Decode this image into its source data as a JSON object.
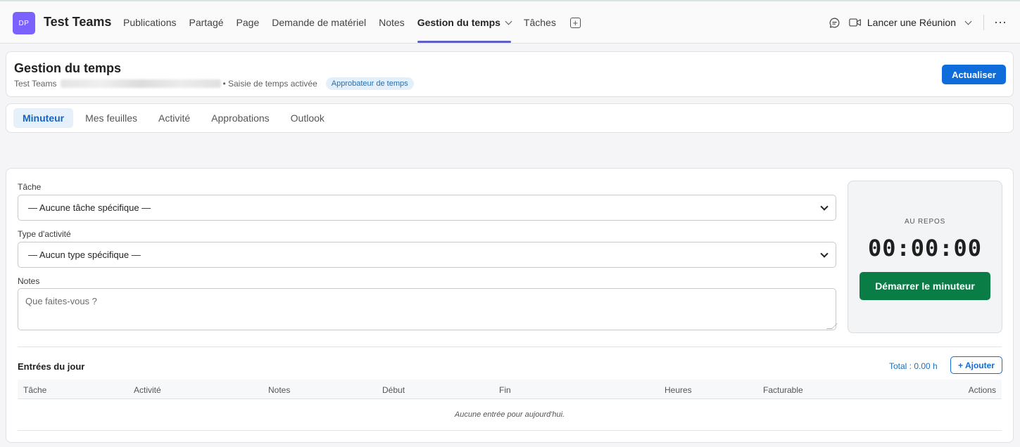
{
  "team": {
    "initials": "DP",
    "name": "Test Teams"
  },
  "nav_tabs": [
    {
      "label": "Publications"
    },
    {
      "label": "Partagé"
    },
    {
      "label": "Page"
    },
    {
      "label": "Demande de matériel"
    },
    {
      "label": "Notes"
    },
    {
      "label": "Gestion du temps"
    },
    {
      "label": "Tâches"
    }
  ],
  "active_tab": "Gestion du temps",
  "meeting": {
    "label": "Lancer une Réunion"
  },
  "page": {
    "title": "Gestion du temps",
    "team_label": "Test Teams",
    "status": "• Saisie de temps activée",
    "role_badge": "Approbateur de temps",
    "refresh_label": "Actualiser"
  },
  "subtabs": [
    {
      "label": "Minuteur"
    },
    {
      "label": "Mes feuilles"
    },
    {
      "label": "Activité"
    },
    {
      "label": "Approbations"
    },
    {
      "label": "Outlook"
    }
  ],
  "active_subtab": "Minuteur",
  "form": {
    "task_label": "Tâche",
    "task_value": "— Aucune tâche spécifique —",
    "activity_label": "Type d'activité",
    "activity_value": "— Aucun type spécifique —",
    "notes_label": "Notes",
    "notes_placeholder": "Que faites-vous ?"
  },
  "timer": {
    "status": "AU REPOS",
    "display": "00:00:00",
    "start_label": "Démarrer le minuteur"
  },
  "entries": {
    "title": "Entrées du jour",
    "total": "Total : 0.00 h",
    "add_label": "+ Ajouter",
    "columns": [
      "Tâche",
      "Activité",
      "Notes",
      "Début",
      "Fin",
      "Heures",
      "Facturable",
      "Actions"
    ],
    "empty_message": "Aucune entrée pour aujourd'hui."
  },
  "colors": {
    "accent": "#5b5fc7",
    "primary_button": "#0f6cdb",
    "start_button": "#0a7d46",
    "avatar": "#7b61ff"
  }
}
